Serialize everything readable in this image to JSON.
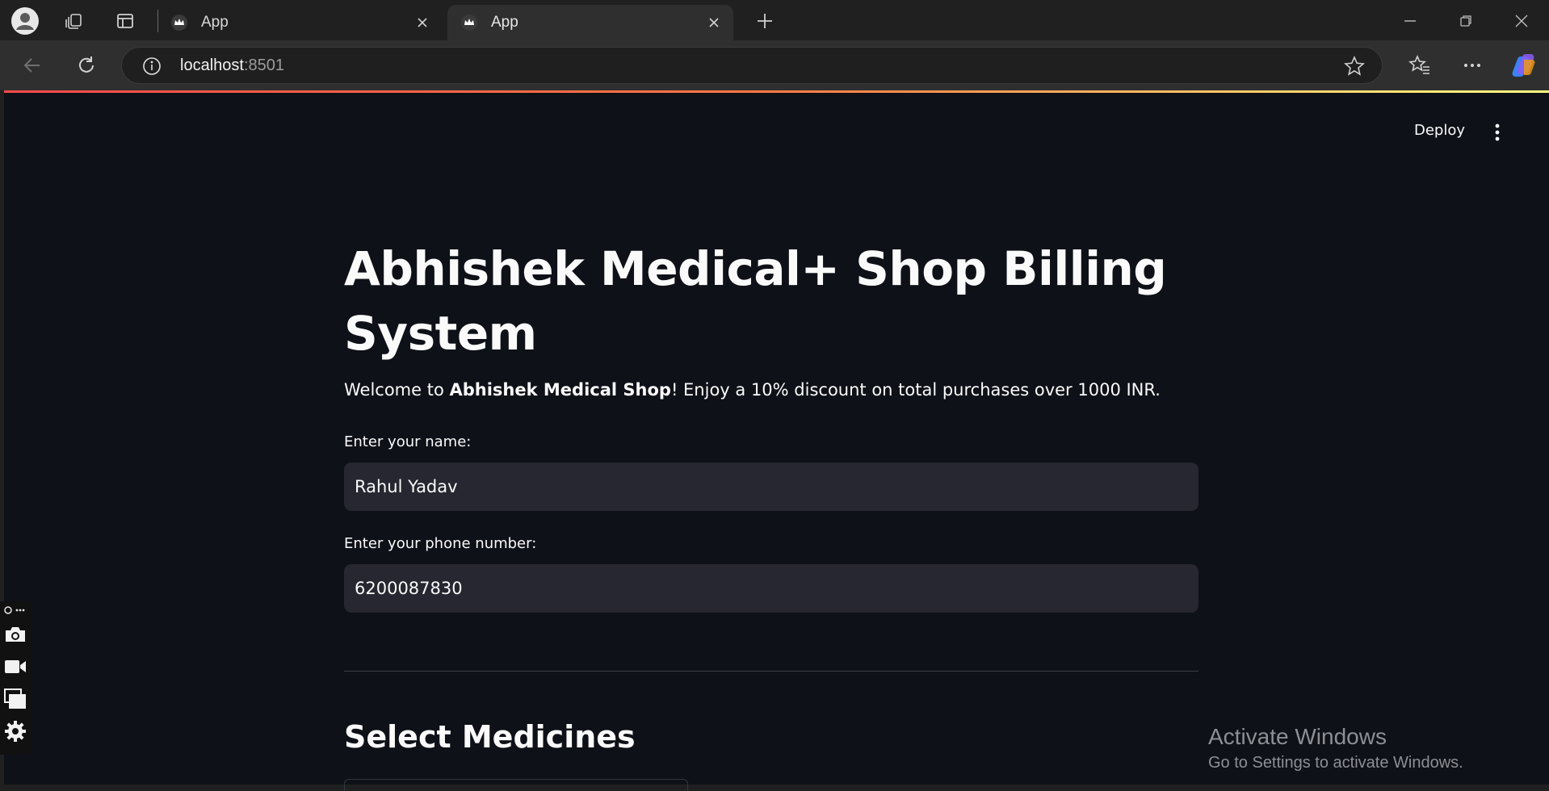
{
  "browser": {
    "tabs": [
      {
        "label": "App",
        "active": false
      },
      {
        "label": "App",
        "active": true
      }
    ],
    "address": {
      "host": "localhost",
      "port": ":8501"
    },
    "icons": [
      "profile-avatar-icon",
      "workspaces-icon",
      "vertical-tabs-icon",
      "new-tab-icon",
      "minimize-icon",
      "restore-icon",
      "close-window-icon",
      "back-icon",
      "refresh-icon",
      "site-info-icon",
      "favorite-star-icon",
      "favorites-icon",
      "more-icon",
      "copilot-icon"
    ]
  },
  "app": {
    "toolbar": {
      "deploy_label": "Deploy"
    },
    "title": "Abhishek Medical+ Shop Billing System",
    "welcome": {
      "prefix": "Welcome to ",
      "shop_name": "Abhishek Medical Shop",
      "suffix": "! Enjoy a 10% discount on total purchases over 1000 INR."
    },
    "name_field": {
      "label": "Enter your name:",
      "value": "Rahul Yadav"
    },
    "phone_field": {
      "label": "Enter your phone number:",
      "value": "6200087830"
    },
    "section_title": "Select Medicines"
  },
  "overlay": {
    "recorder_tools": [
      "camera-icon",
      "video-icon",
      "windows-icon",
      "settings-icon"
    ]
  },
  "watermark": {
    "title": "Activate Windows",
    "subtitle": "Go to Settings to activate Windows."
  },
  "colors": {
    "app_background": "#0e1117",
    "input_background": "#262730",
    "accent_gradient_start": "#ff4b4b",
    "accent_gradient_end": "#fffd80",
    "chrome_background": "#202020"
  }
}
